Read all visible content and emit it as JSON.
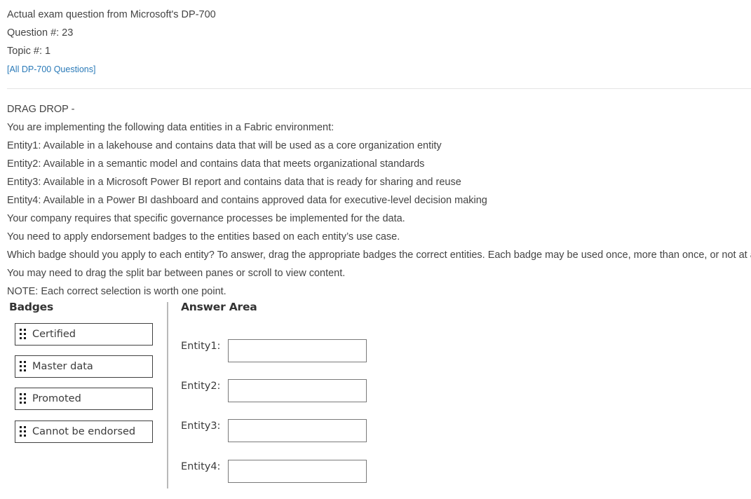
{
  "header": {
    "exam_line": "Actual exam question from Microsoft's DP-700",
    "question_number": "Question #: 23",
    "topic": "Topic #: 1",
    "all_questions_link": "[All DP-700 Questions]"
  },
  "question": {
    "type": "DRAG DROP -",
    "lines": [
      "You are implementing the following data entities in a Fabric environment:",
      "Entity1: Available in a lakehouse and contains data that will be used as a core organization entity",
      "Entity2: Available in a semantic model and contains data that meets organizational standards",
      "Entity3: Available in a Microsoft Power BI report and contains data that is ready for sharing and reuse",
      "Entity4: Available in a Power BI dashboard and contains approved data for executive-level decision making",
      "Your company requires that specific governance processes be implemented for the data.",
      "You need to apply endorsement badges to the entities based on each entity’s use case.",
      "Which badge should you apply to each entity? To answer, drag the appropriate badges the correct entities. Each badge may be used once, more than once, or not at all.",
      "You may need to drag the split bar between panes or scroll to view content.",
      "NOTE: Each correct selection is worth one point."
    ]
  },
  "exhibit": {
    "badges_title": "Badges",
    "answer_title": "Answer Area",
    "badges": [
      "Certified",
      "Master data",
      "Promoted",
      "Cannot be endorsed"
    ],
    "entities": [
      "Entity1:",
      "Entity2:",
      "Entity3:",
      "Entity4:"
    ]
  }
}
